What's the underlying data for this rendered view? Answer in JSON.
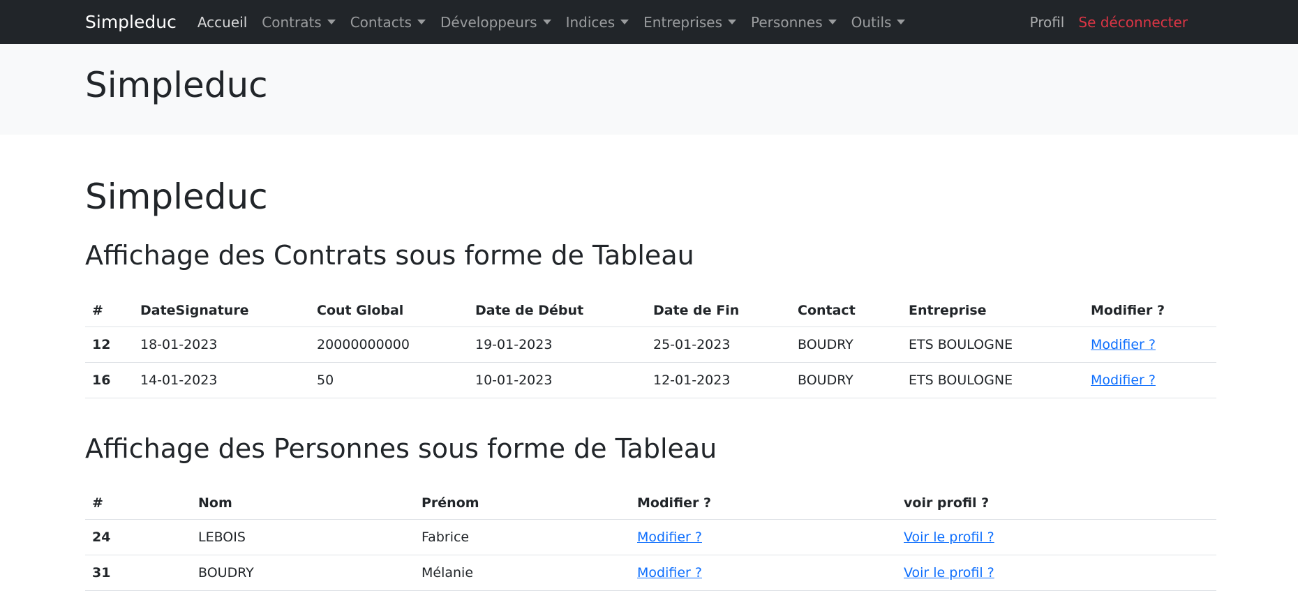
{
  "navbar": {
    "brand": "Simpleduc",
    "items": [
      {
        "label": "Accueil",
        "dropdown": false,
        "active": true
      },
      {
        "label": "Contrats",
        "dropdown": true
      },
      {
        "label": "Contacts",
        "dropdown": true
      },
      {
        "label": "Développeurs",
        "dropdown": true
      },
      {
        "label": "Indices",
        "dropdown": true
      },
      {
        "label": "Entreprises",
        "dropdown": true
      },
      {
        "label": "Personnes",
        "dropdown": true
      },
      {
        "label": "Outils",
        "dropdown": true
      }
    ],
    "profile": "Profil",
    "logout": "Se déconnecter"
  },
  "hero": {
    "title": "Simpleduc"
  },
  "main": {
    "title": "Simpleduc",
    "contrats": {
      "heading": "Affichage des Contrats sous forme de Tableau",
      "columns": [
        "#",
        "DateSignature",
        "Cout Global",
        "Date de Début",
        "Date de Fin",
        "Contact",
        "Entreprise",
        "Modifier ?"
      ],
      "rows": [
        {
          "id": "12",
          "date_signature": "18-01-2023",
          "cout": "20000000000",
          "debut": "19-01-2023",
          "fin": "25-01-2023",
          "contact": "BOUDRY",
          "entreprise": "ETS BOULOGNE",
          "modifier": "Modifier ?"
        },
        {
          "id": "16",
          "date_signature": "14-01-2023",
          "cout": "50",
          "debut": "10-01-2023",
          "fin": "12-01-2023",
          "contact": "BOUDRY",
          "entreprise": "ETS BOULOGNE",
          "modifier": "Modifier ?"
        }
      ]
    },
    "personnes": {
      "heading": "Affichage des Personnes sous forme de Tableau",
      "columns": [
        "#",
        "Nom",
        "Prénom",
        "Modifier ?",
        "voir profil ?"
      ],
      "rows": [
        {
          "id": "24",
          "nom": "LEBOIS",
          "prenom": "Fabrice",
          "modifier": "Modifier ?",
          "profil": "Voir le profil ?"
        },
        {
          "id": "31",
          "nom": "BOUDRY",
          "prenom": "Mélanie",
          "modifier": "Modifier ?",
          "profil": "Voir le profil ?"
        }
      ]
    }
  },
  "colors": {
    "navbar_bg": "#212529",
    "hero_bg": "#f8f9fa",
    "link": "#0d6efd",
    "logout": "#dc3545"
  }
}
